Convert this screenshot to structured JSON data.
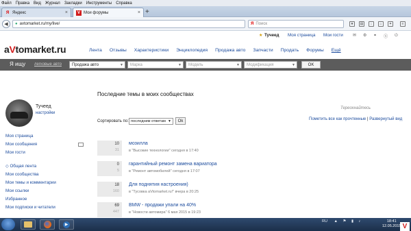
{
  "menubar": [
    "Файл",
    "Правка",
    "Вид",
    "Журнал",
    "Закладки",
    "Инструменты",
    "Справка"
  ],
  "tabs": [
    {
      "title": "Яндекс",
      "icon": "yandex-icon"
    },
    {
      "title": "Мои форумы",
      "icon": "avtomarket-icon"
    }
  ],
  "url": "avtomarket.ru/my/live/",
  "search_placeholder": "Поиск",
  "userbar": {
    "username": "Тучеед",
    "my_page": "Моя страница",
    "my_guests": "Мои гости"
  },
  "logo": {
    "a": "a",
    "v": "V",
    "rest": "tomarket.ru"
  },
  "mainnav": [
    "Лента",
    "Отзывы",
    "Характеристики",
    "Энциклопедия",
    "Продажа авто",
    "Запчасти",
    "Продать",
    "Форумы",
    "Ещё"
  ],
  "searchbar": {
    "label": "Я ищу",
    "legk": "легковые авто",
    "category": "Продажа авто",
    "brand": "Марка",
    "model": "Модель",
    "mod": "Модификация",
    "ok": "OK"
  },
  "sidebar": {
    "name": "Тучеед",
    "settings": "настройки",
    "group1": [
      "Моя страница",
      "Мои сообщения",
      "Мои гости"
    ],
    "group2": [
      "Общая лента",
      "Мои сообщества",
      "Мои темы и комментарии",
      "Мои ссылки",
      "Избранное",
      "Мои подписки и читатели"
    ]
  },
  "main": {
    "title": "Последние темы в моих сообществах",
    "sort_label": "Сортировать по:",
    "sort_value": "последним ответам",
    "sort_ok": "Ok",
    "thanks": "Тереохнайтесь",
    "mark_read": "Пометить все как прочтенные",
    "sep": "|",
    "expanded": "Развернутый вид",
    "topics": [
      {
        "title": "мозилла",
        "community": "\"Высокие технологии\"",
        "time": "сегодня в 17:40",
        "count": "10",
        "views": "31"
      },
      {
        "title": "гарантийный ремонт замена вариатора",
        "community": "\"Ремонт автомобилей\"",
        "time": "сегодня в 17:07",
        "count": "0",
        "views": "5"
      },
      {
        "title": "Для поднятия настроения)",
        "community": "\"Тусовка aVtomarket.ru!\"",
        "time": "вчера в 20:25",
        "count": "18",
        "views": "160"
      },
      {
        "title": "BMW - продажи упали на 40%",
        "community": "\"Новости автомира\"",
        "time": "6 мая 2015 в 19:23",
        "count": "69",
        "views": "447"
      }
    ],
    "in_prefix": "в"
  },
  "taskbar": {
    "lang": "RU",
    "time": "18:41",
    "date": "12.05.2015"
  }
}
